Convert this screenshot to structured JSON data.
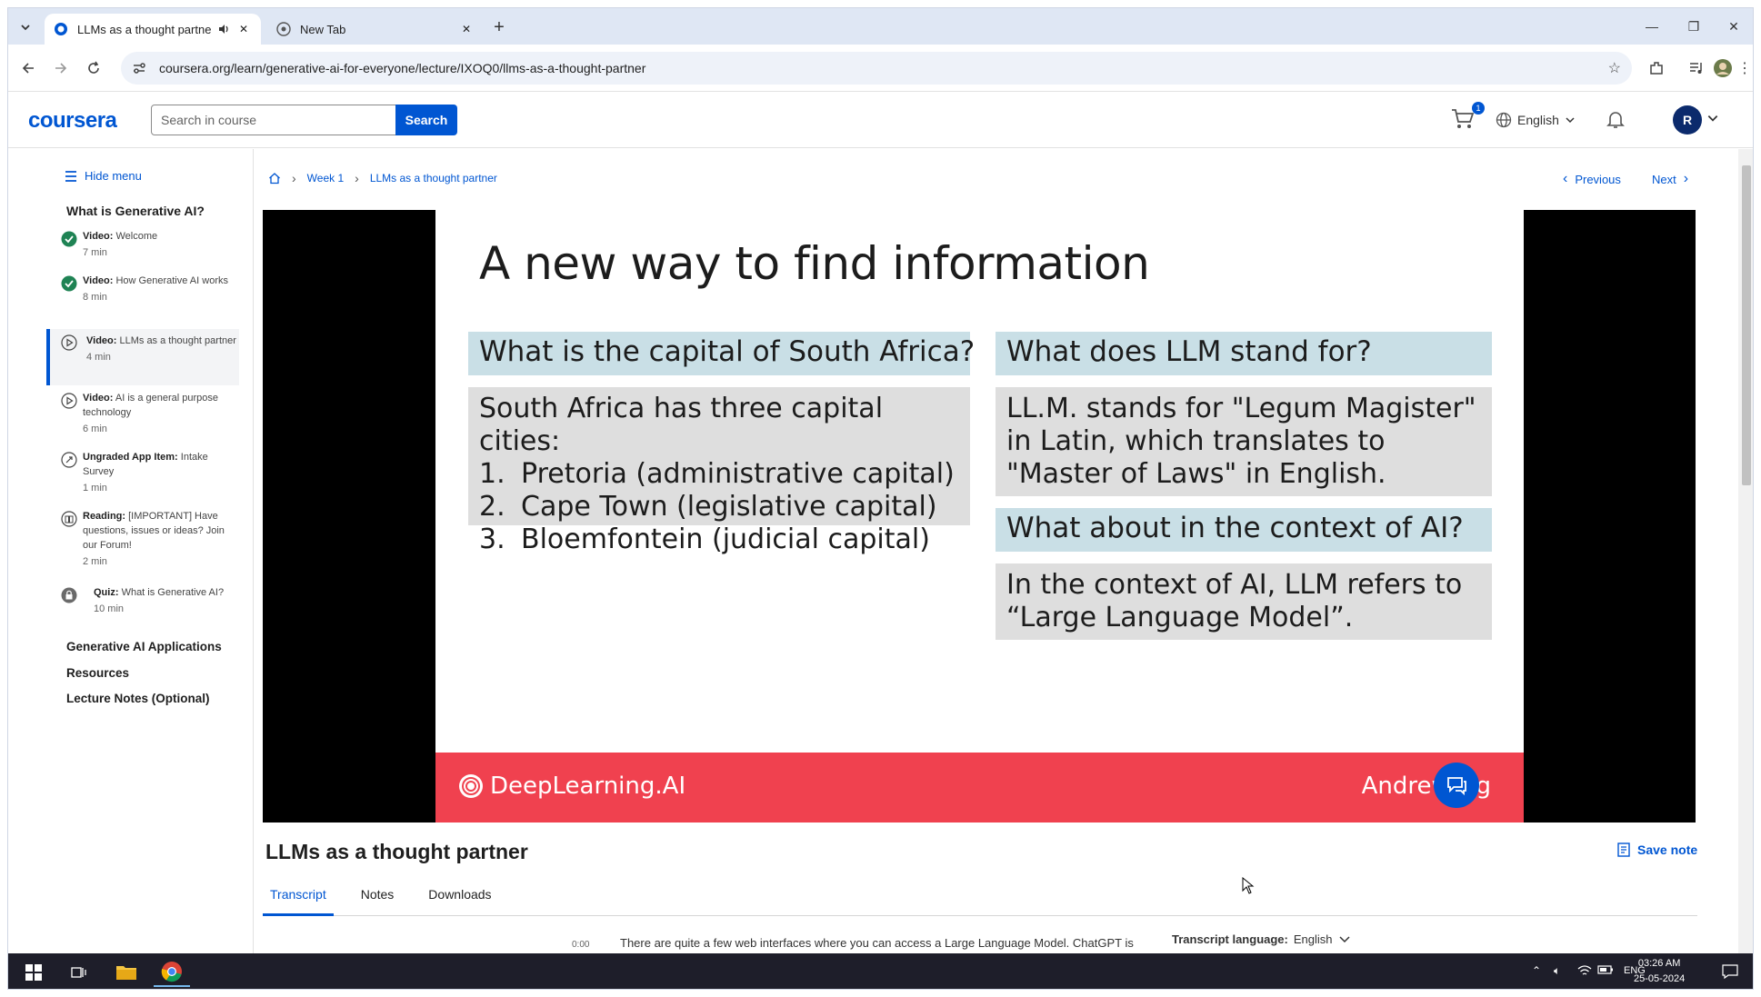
{
  "browser": {
    "tabs": [
      {
        "title": "LLMs as a thought partner",
        "active": true
      },
      {
        "title": "New Tab",
        "active": false
      }
    ],
    "url": "coursera.org/learn/generative-ai-for-everyone/lecture/IXOQ0/llms-as-a-thought-partner"
  },
  "header": {
    "logo": "coursera",
    "search_placeholder": "Search in course",
    "search_button": "Search",
    "cart_count": "1",
    "language": "English",
    "avatar_initial": "R"
  },
  "sidebar": {
    "hide_menu": "Hide menu",
    "module_title": "What is Generative AI?",
    "lessons": [
      {
        "kind": "Video:",
        "title": "Welcome",
        "duration": "7 min",
        "status": "completed"
      },
      {
        "kind": "Video:",
        "title": "How Generative AI works",
        "duration": "8 min",
        "status": "completed"
      },
      {
        "kind": "Video:",
        "title": "LLMs as a thought partner",
        "duration": "4 min",
        "status": "current"
      },
      {
        "kind": "Video:",
        "title": "AI is a general purpose technology",
        "duration": "6 min",
        "status": "todo"
      },
      {
        "kind": "Ungraded App Item:",
        "title": "Intake Survey",
        "duration": "1 min",
        "status": "todo"
      },
      {
        "kind": "Reading:",
        "title": "[IMPORTANT] Have questions, issues or ideas? Join our Forum!",
        "duration": "2 min",
        "status": "todo"
      },
      {
        "kind": "Quiz:",
        "title": "What is Generative AI?",
        "duration": "10 min",
        "status": "locked"
      }
    ],
    "other_modules": [
      "Generative AI Applications",
      "Resources",
      "Lecture Notes (Optional)"
    ]
  },
  "main": {
    "breadcrumb": [
      "Week 1",
      "LLMs as a thought partner"
    ],
    "previous": "Previous",
    "next": "Next",
    "lecture_title": "LLMs as a thought partner",
    "save_note": "Save note",
    "tabs": [
      "Transcript",
      "Notes",
      "Downloads"
    ],
    "transcript_time": "0:00",
    "transcript_text": "There are quite a few web interfaces where you can access a Large Language Model. ChatGPT is",
    "transcript_language_label": "Transcript language:",
    "transcript_language": "English"
  },
  "slide": {
    "title": "A new way to find information",
    "q1": "What is the capital of South Africa?",
    "a1_intro": "South Africa has three capital cities:",
    "a1_items": [
      "Pretoria (administrative capital)",
      "Cape Town (legislative capital)",
      "Bloemfontein (judicial capital)"
    ],
    "a1_nums": [
      "1.",
      "2.",
      "3."
    ],
    "q2": "What does LLM stand for?",
    "a2": "LL.M. stands for \"Legum Magister\" in Latin, which translates to \"Master of Laws\" in English.",
    "q3": "What about in the context of AI?",
    "a3": "In the context of AI, LLM refers to “Large Language Model”.",
    "brand": "DeepLearning.AI",
    "presenter": "Andrew Ng"
  },
  "taskbar": {
    "lang": "ENG",
    "time": "03:26 AM",
    "date": "25-05-2024"
  },
  "colors": {
    "accent": "#0056d2",
    "slide_footer": "#f0414f",
    "question_bg": "#c9dfe6",
    "answer_bg": "#dedede",
    "completed": "#1f8354"
  }
}
